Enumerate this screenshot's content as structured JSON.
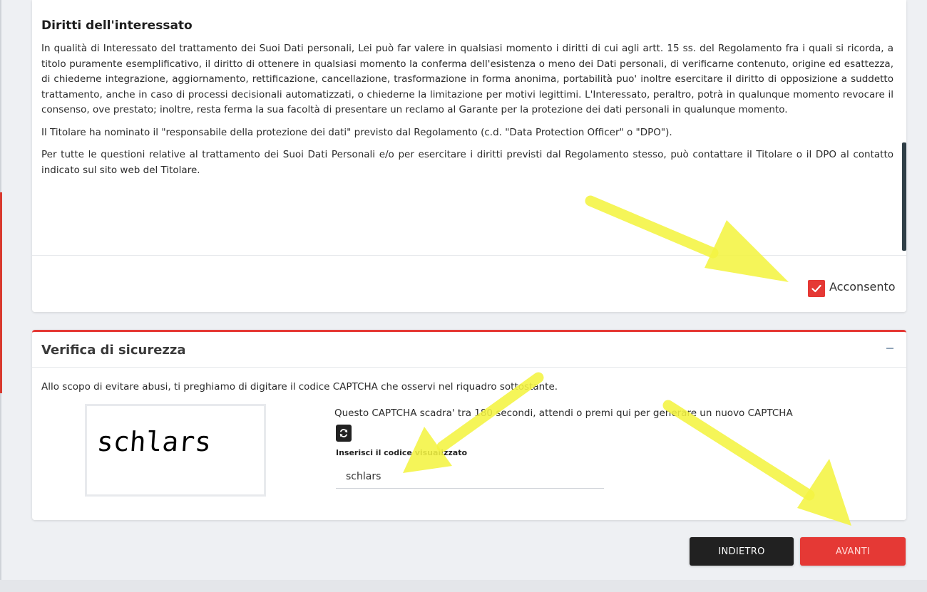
{
  "consent": {
    "title": "Diritti dell'interessato",
    "paragraphs": [
      "In qualità di Interessato del trattamento dei Suoi Dati personali, Lei può far valere in qualsiasi momento i diritti di cui agli artt. 15 ss. del Regolamento fra i quali si ricorda, a titolo puramente esemplificativo, il diritto di ottenere in qualsiasi momento la conferma dell'esistenza o meno dei Dati personali, di verificarne contenuto, origine ed esattezza, di chiederne integrazione, aggiornamento, rettificazione, cancellazione, trasformazione in forma anonima, portabilità puo' inoltre esercitare il diritto di opposizione a suddetto trattamento, anche in caso di processi decisionali automatizzati, o chiederne la limitazione per motivi legittimi. L'Interessato, peraltro, potrà in qualunque momento revocare il consenso, ove prestato; inoltre, resta ferma la sua facoltà di presentare un reclamo al Garante per la protezione dei dati personali in qualunque momento.",
      "Il Titolare ha nominato il \"responsabile della protezione dei dati\" previsto dal Regolamento (c.d. \"Data Protection Officer\" o \"DPO\").",
      "Per tutte le questioni relative al trattamento dei Suoi Dati Personali e/o per esercitare i diritti previsti dal Regolamento stesso, può contattare il Titolare o il DPO al contatto indicato sul sito web del Titolare."
    ],
    "checkbox_label": "Acconsento",
    "checked": true
  },
  "security": {
    "title": "Verifica di sicurezza",
    "intro": "Allo scopo di evitare abusi, ti preghiamo di digitare il codice CAPTCHA che osservi nel riquadro sottostante.",
    "captcha_text": "schlars",
    "expiry_text": "Questo CAPTCHA scadra' tra 180 secondi, attendi o premi qui per generare un nuovo CAPTCHA",
    "input_label": "Inserisci il codice visualizzato",
    "input_value": "schlars"
  },
  "buttons": {
    "back": "INDIETRO",
    "next": "AVANTI"
  },
  "colors": {
    "accent": "#e53935",
    "dark_button": "#212121",
    "annotation_arrow": "#f4f442"
  },
  "icons": {
    "checkbox": "check-icon",
    "refresh": "refresh-icon",
    "collapse": "minus-icon"
  }
}
